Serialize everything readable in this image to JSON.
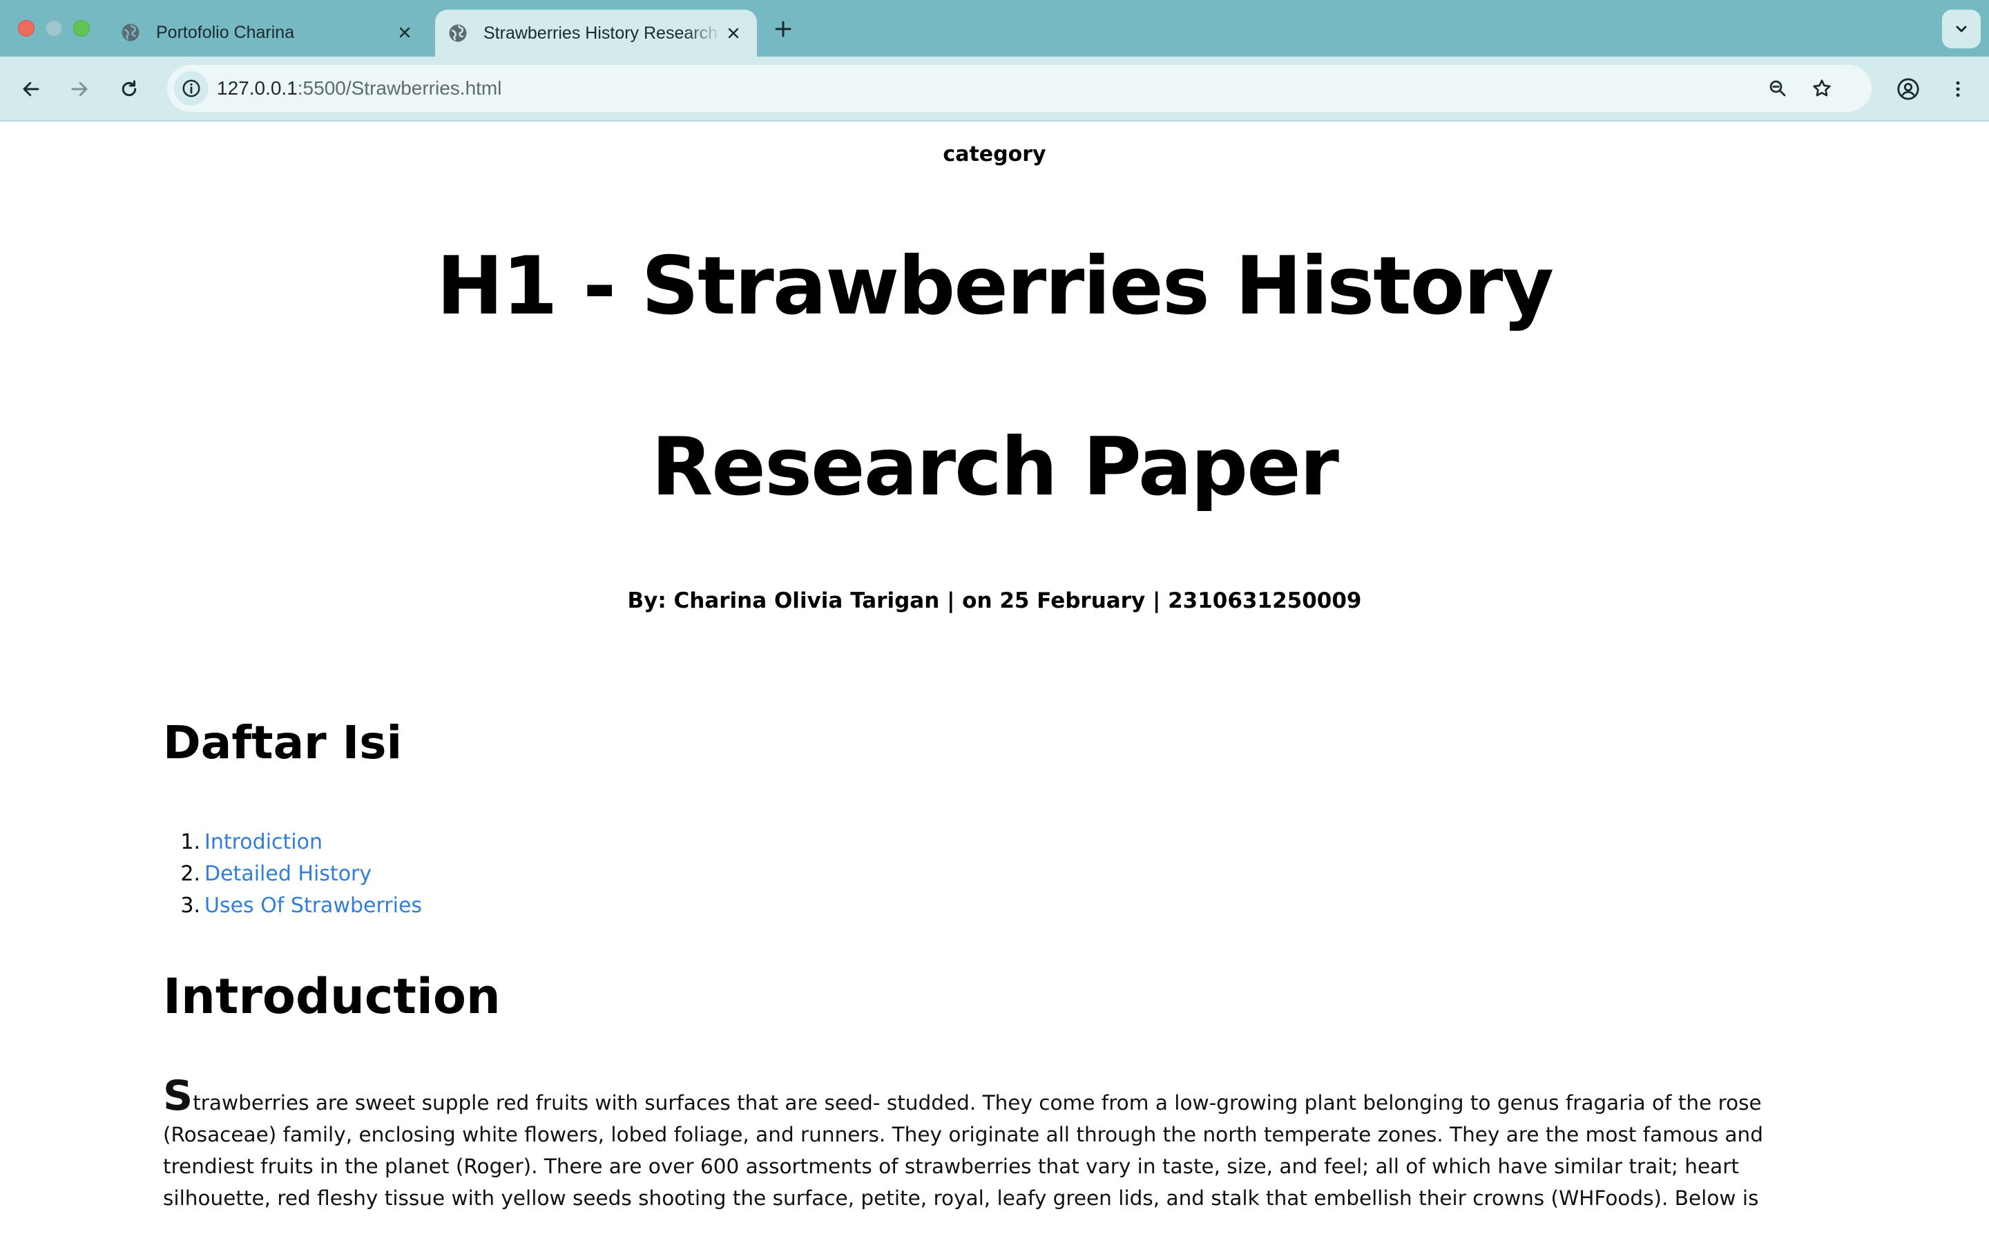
{
  "browser": {
    "tabs": [
      {
        "title": "Portofolio Charina",
        "active": false
      },
      {
        "title": "Strawberries History Research Paper",
        "active": true
      }
    ],
    "url_host": "127.0.0.1",
    "url_rest": ":5500/Strawberries.html"
  },
  "page": {
    "category": "category",
    "title_line1": "H1 - Strawberries History",
    "title_line2": "Research Paper",
    "byline": "By: Charina Olivia Tarigan | on 25 February | 2310631250009",
    "toc_title": "Daftar Isi",
    "toc": [
      {
        "num": "1.",
        "label": "Introdiction"
      },
      {
        "num": "2.",
        "label": "Detailed History"
      },
      {
        "num": "3.",
        "label": "Uses Of Strawberries"
      }
    ],
    "intro_title": "Introduction",
    "intro_dropcap": "S",
    "intro_text": "trawberries are sweet supple red fruits with surfaces that are seed- studded. They come from a low-growing plant belonging to genus fragaria of the rose (Rosaceae) family, enclosing white flowers, lobed foliage, and runners. They originate all through the north temperate zones. They are the most famous and trendiest fruits in the planet (Roger). There are over 600 assortments of strawberries that vary in taste, size, and feel; all of which have similar trait; heart silhouette, red fleshy tissue with yellow seeds shooting the surface, petite, royal, leafy green lids, and stalk that embellish their crowns (WHFoods). Below is"
  },
  "colors": {
    "tabbar": "#76b9c3",
    "toolbar": "#d4ebee",
    "link": "#2f7fd8"
  }
}
